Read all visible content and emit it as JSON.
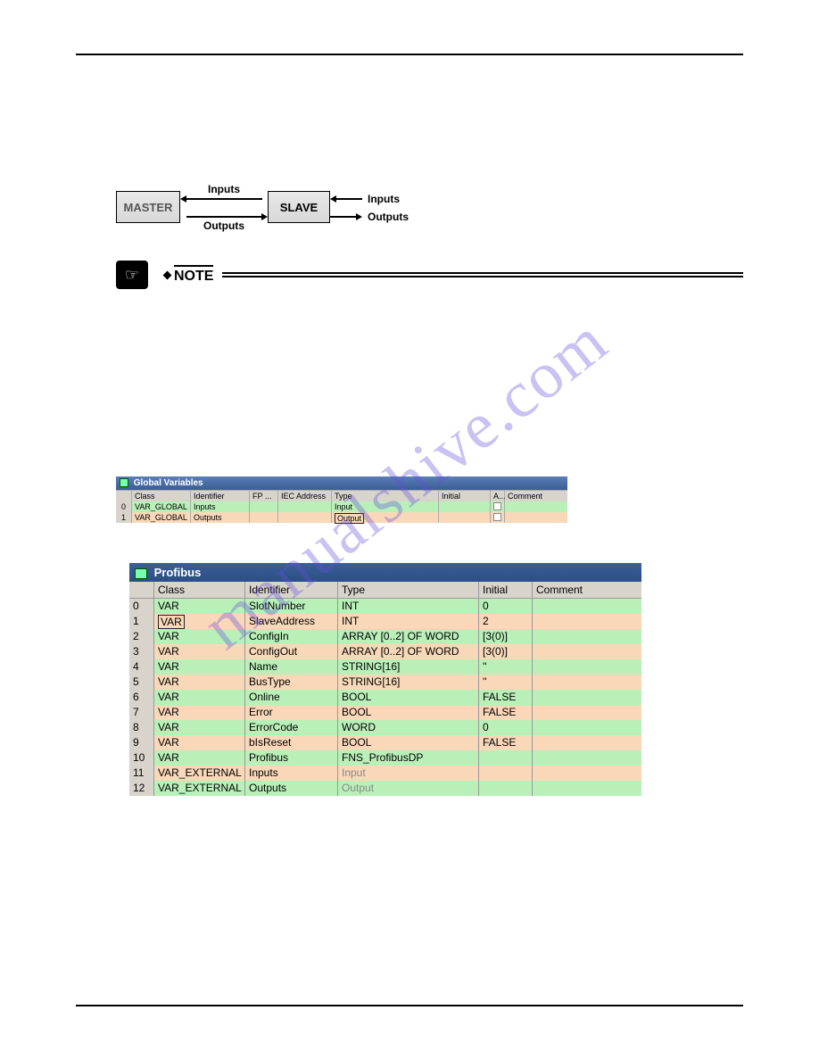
{
  "diagram": {
    "master": "MASTER",
    "slave": "SLAVE",
    "inputs": "Inputs",
    "outputs": "Outputs"
  },
  "note": {
    "label": "NOTE"
  },
  "watermark": "manualshive.com",
  "gv": {
    "title": "Global Variables",
    "headers": {
      "class": "Class",
      "identifier": "Identifier",
      "fp": "FP ...",
      "iec": "IEC Address",
      "type": "Type",
      "initial": "Initial",
      "a": "A...",
      "comment": "Comment"
    },
    "rows": [
      {
        "n": "0",
        "class": "VAR_GLOBAL",
        "identifier": "Inputs",
        "type": "Input"
      },
      {
        "n": "1",
        "class": "VAR_GLOBAL",
        "identifier": "Outputs",
        "type": "Output"
      }
    ]
  },
  "pf": {
    "title": "Profibus",
    "headers": {
      "class": "Class",
      "identifier": "Identifier",
      "type": "Type",
      "initial": "Initial",
      "comment": "Comment"
    },
    "rows": [
      {
        "n": "0",
        "class": "VAR",
        "identifier": "SlotNumber",
        "type": "INT",
        "initial": "0"
      },
      {
        "n": "1",
        "class": "VAR",
        "boxed": true,
        "identifier": "SlaveAddress",
        "type": "INT",
        "initial": "2"
      },
      {
        "n": "2",
        "class": "VAR",
        "identifier": "ConfigIn",
        "type": "ARRAY [0..2] OF WORD",
        "initial": "[3(0)]"
      },
      {
        "n": "3",
        "class": "VAR",
        "identifier": "ConfigOut",
        "type": "ARRAY [0..2] OF WORD",
        "initial": "[3(0)]"
      },
      {
        "n": "4",
        "class": "VAR",
        "identifier": "Name",
        "type": "STRING[16]",
        "initial": "''"
      },
      {
        "n": "5",
        "class": "VAR",
        "identifier": "BusType",
        "type": "STRING[16]",
        "initial": "''"
      },
      {
        "n": "6",
        "class": "VAR",
        "identifier": "Online",
        "type": "BOOL",
        "initial": "FALSE"
      },
      {
        "n": "7",
        "class": "VAR",
        "identifier": "Error",
        "type": "BOOL",
        "initial": "FALSE"
      },
      {
        "n": "8",
        "class": "VAR",
        "identifier": "ErrorCode",
        "type": "WORD",
        "initial": "0"
      },
      {
        "n": "9",
        "class": "VAR",
        "identifier": "bIsReset",
        "type": "BOOL",
        "initial": "FALSE"
      },
      {
        "n": "10",
        "class": "VAR",
        "identifier": "Profibus",
        "type": "FNS_ProfibusDP",
        "initial": ""
      },
      {
        "n": "11",
        "class": "VAR_EXTERNAL",
        "identifier": "Inputs",
        "type": "Input",
        "gray": true,
        "initial": ""
      },
      {
        "n": "12",
        "class": "VAR_EXTERNAL",
        "identifier": "Outputs",
        "type": "Output",
        "gray": true,
        "initial": ""
      }
    ]
  }
}
